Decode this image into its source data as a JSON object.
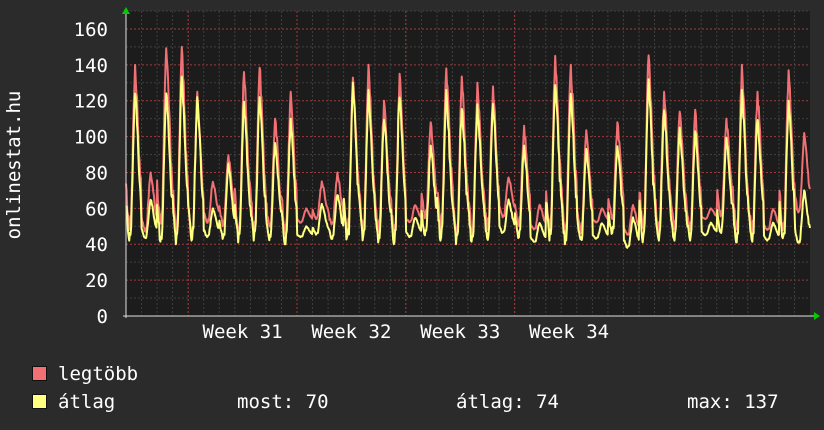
{
  "chart_data": {
    "type": "line",
    "ylabel": "onlinestat.hu",
    "ylim": [
      0,
      170
    ],
    "y_ticks": [
      0,
      20,
      40,
      60,
      80,
      100,
      120,
      140,
      160
    ],
    "x_tick_labels": [
      "Week 31",
      "Week 32",
      "Week 33",
      "Week 34"
    ],
    "grid": true,
    "samples_per_day": 24,
    "series": [
      {
        "name": "legtöbb",
        "color": "#f07074",
        "daily_peaks": [
          140,
          80,
          152,
          150,
          125,
          75,
          90,
          136,
          140,
          110,
          125,
          60,
          75,
          80,
          136,
          140,
          120,
          135,
          62,
          108,
          138,
          135,
          130,
          128,
          78,
          106,
          62,
          145,
          140,
          105,
          60,
          108,
          62,
          146,
          125,
          115,
          115,
          60,
          110,
          140,
          125,
          60,
          137,
          102
        ],
        "daily_lows": [
          48,
          47,
          48,
          45,
          44,
          52,
          50,
          46,
          47,
          48,
          46,
          52,
          54,
          50,
          46,
          47,
          47,
          45,
          52,
          54,
          48,
          46,
          46,
          47,
          55,
          50,
          48,
          47,
          46,
          46,
          52,
          53,
          45,
          46,
          47,
          48,
          48,
          54,
          55,
          46,
          46,
          48,
          46,
          56
        ]
      },
      {
        "name": "átlag",
        "color": "#ffff80",
        "daily_peaks": [
          126,
          65,
          126,
          136,
          122,
          60,
          85,
          120,
          122,
          98,
          110,
          50,
          63,
          68,
          130,
          126,
          112,
          125,
          55,
          95,
          126,
          118,
          118,
          120,
          65,
          95,
          52,
          132,
          126,
          95,
          52,
          95,
          55,
          132,
          116,
          105,
          103,
          52,
          100,
          126,
          112,
          52,
          120,
          70
        ],
        "daily_lows": [
          42,
          43,
          41,
          40,
          42,
          44,
          43,
          41,
          42,
          42,
          40,
          44,
          45,
          43,
          41,
          42,
          41,
          40,
          44,
          45,
          42,
          40,
          41,
          42,
          46,
          43,
          41,
          42,
          40,
          41,
          43,
          45,
          38,
          41,
          42,
          42,
          42,
          45,
          46,
          41,
          41,
          42,
          41,
          40
        ]
      }
    ]
  },
  "legend": {
    "items": [
      {
        "label": "legtöbb",
        "color": "#f07074"
      },
      {
        "label": "átlag",
        "color": "#ffff80"
      }
    ]
  },
  "stats": {
    "current": "most: 70",
    "average": "átlag: 74",
    "max": "max: 137"
  }
}
